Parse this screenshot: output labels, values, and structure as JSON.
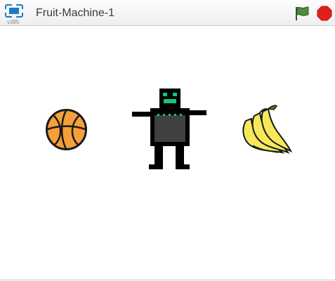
{
  "player": {
    "title": "Fruit-Machine-1",
    "version": "v385"
  },
  "controls": {
    "fullscreen_icon": "fullscreen-icon",
    "green_flag_icon": "green-flag-icon",
    "stop_icon": "stop-sign-icon"
  },
  "colors": {
    "titlebar_bg": "#f2f2f2",
    "fullscreen_blue": "#1a7dc4",
    "flag_green": "#4c8c3a",
    "stop_red": "#e0201c",
    "basketball_orange": "#f5a03a",
    "robot_body": "#000000",
    "robot_panel": "#404040",
    "robot_eyes": "#19c27a",
    "banana_yellow": "#f6e85a"
  },
  "stage": {
    "sprites": [
      "basketball",
      "robot",
      "banana"
    ]
  }
}
